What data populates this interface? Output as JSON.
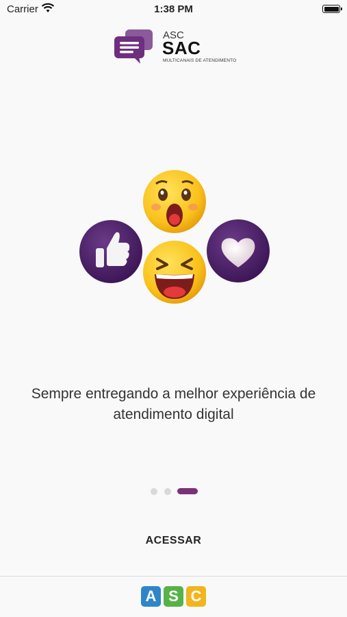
{
  "status_bar": {
    "carrier": "Carrier",
    "time": "1:38 PM"
  },
  "brand": {
    "prefix": "ASC",
    "name": "SAC",
    "subtitle": "MULTICANAIS DE ATENDIMENTO",
    "accent": "#6e2f7f"
  },
  "hero": {
    "emojis": [
      "surprised-face-icon",
      "laughing-face-icon",
      "thumbs-up-icon",
      "heart-icon"
    ]
  },
  "tagline": "Sempre entregando a melhor experiência de atendimento digital",
  "pager": {
    "pages": 3,
    "current": 3,
    "active_color": "#7b3178"
  },
  "access_button": "ACESSAR",
  "footer_logo": {
    "letters": [
      "A",
      "S",
      "C"
    ],
    "colors": [
      "#2e86c9",
      "#57b247",
      "#f2b51d"
    ]
  }
}
